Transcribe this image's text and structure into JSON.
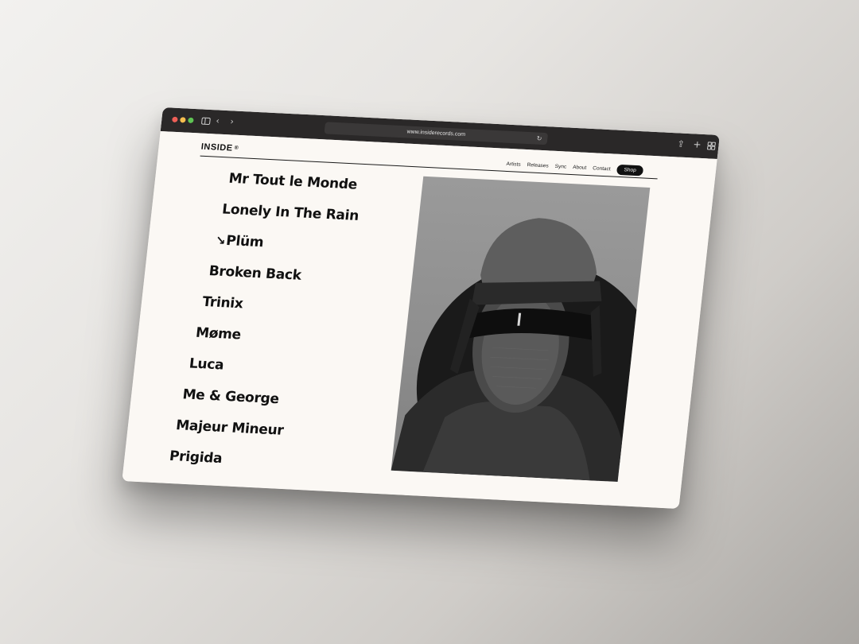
{
  "browser": {
    "url": "www.insiderecords.com"
  },
  "site": {
    "logo": "INSIDE",
    "logo_mark": "®",
    "nav": [
      {
        "label": "Artists"
      },
      {
        "label": "Releases"
      },
      {
        "label": "Sync"
      },
      {
        "label": "About"
      },
      {
        "label": "Contact"
      }
    ],
    "shop_label": "Shop"
  },
  "artists": [
    {
      "name": "Mr Tout le Monde"
    },
    {
      "name": "Lonely In The Rain"
    },
    {
      "name": "Plüm",
      "active": true
    },
    {
      "name": "Broken Back"
    },
    {
      "name": "Trinix"
    },
    {
      "name": "Møme"
    },
    {
      "name": "Luca"
    },
    {
      "name": "Me & George"
    },
    {
      "name": "Majeur Mineur"
    },
    {
      "name": "Prigida"
    }
  ],
  "icons": {
    "active_artist": "arrow-down-right-icon",
    "back": "chevron-left-icon",
    "forward": "chevron-right-icon",
    "reload": "reload-icon",
    "share": "share-icon",
    "new_tab": "plus-icon",
    "tabs": "tabs-overview-icon"
  }
}
